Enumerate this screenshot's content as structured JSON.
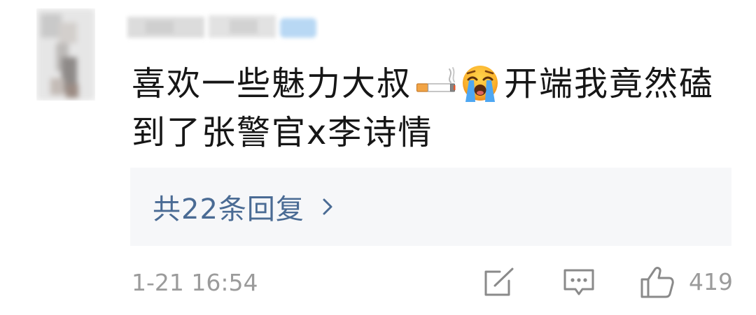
{
  "header": {
    "avatar_icon": "avatar-redacted",
    "username_redacted": true
  },
  "comment": {
    "line1_start": "喜欢一些魅力大叔",
    "emojis": [
      "cigarette-icon",
      "loudly-crying-face-icon"
    ],
    "line1_end": "开端我竟然磕",
    "line2": "到了张警官x李诗情"
  },
  "replies": {
    "label": "共22条回复",
    "icon": "chevron-right-icon"
  },
  "footer": {
    "timestamp": "1-21 16:54",
    "actions": [
      {
        "icon": "edit-icon"
      },
      {
        "icon": "comment-icon"
      },
      {
        "icon": "like-icon",
        "count": "419"
      }
    ]
  },
  "colors": {
    "text": "#161616",
    "secondary_text": "#9b9b9b",
    "reply_link": "#4a6b94",
    "reply_background": "#f6f7f9",
    "icon_gray": "#8a8a8a"
  }
}
